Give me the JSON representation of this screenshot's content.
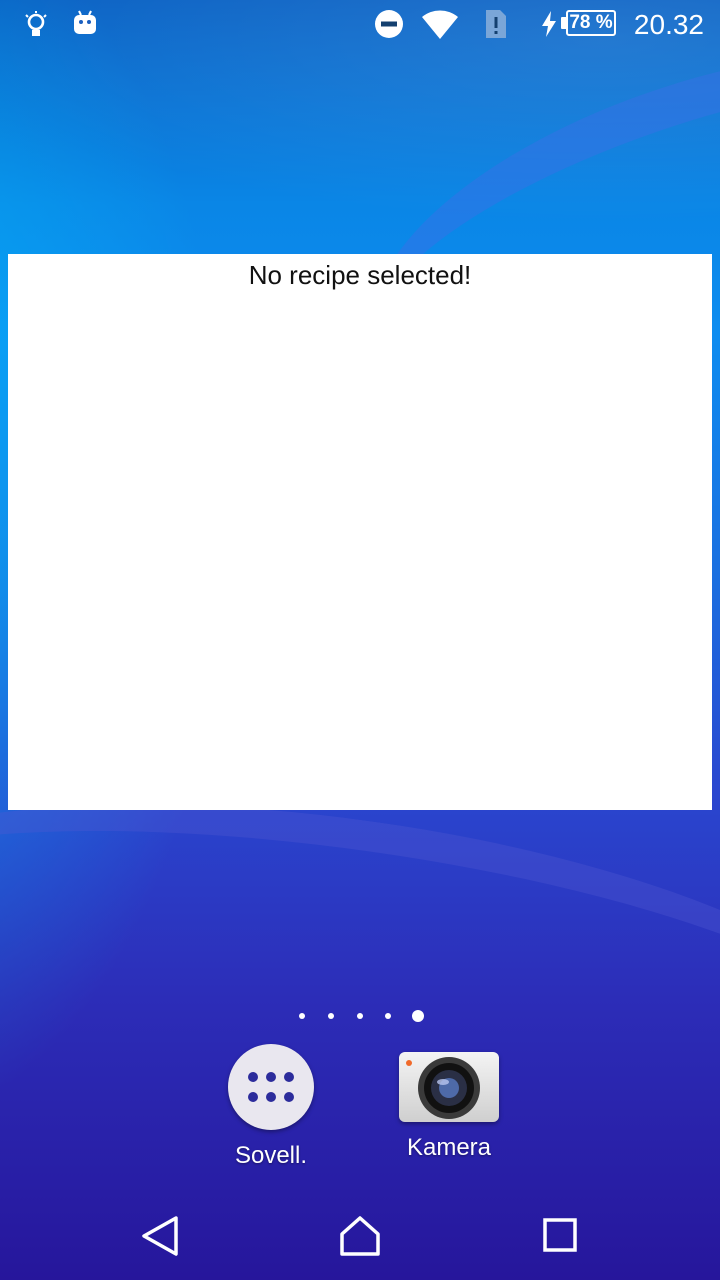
{
  "status_bar": {
    "icons": [
      "lightbulb-icon",
      "android-debug-icon",
      "do-not-disturb-icon",
      "wifi-icon",
      "sim-alert-icon",
      "charging-icon"
    ],
    "battery_percent": "78 %",
    "time": "20.32"
  },
  "widget": {
    "message": "No recipe selected!"
  },
  "home": {
    "page_count": 5,
    "active_page": 5
  },
  "dock": {
    "apps": [
      {
        "label": "Sovell.",
        "icon": "app-drawer-icon"
      },
      {
        "label": "Kamera",
        "icon": "camera-icon"
      }
    ]
  },
  "nav_bar": {
    "buttons": [
      "back-icon",
      "home-icon",
      "recents-icon"
    ]
  },
  "colors": {
    "wallpaper_top": "#0b63c5",
    "wallpaper_bottom": "#26169b",
    "widget_background": "#ffffff",
    "apps_dot": "#2c2c9c"
  }
}
